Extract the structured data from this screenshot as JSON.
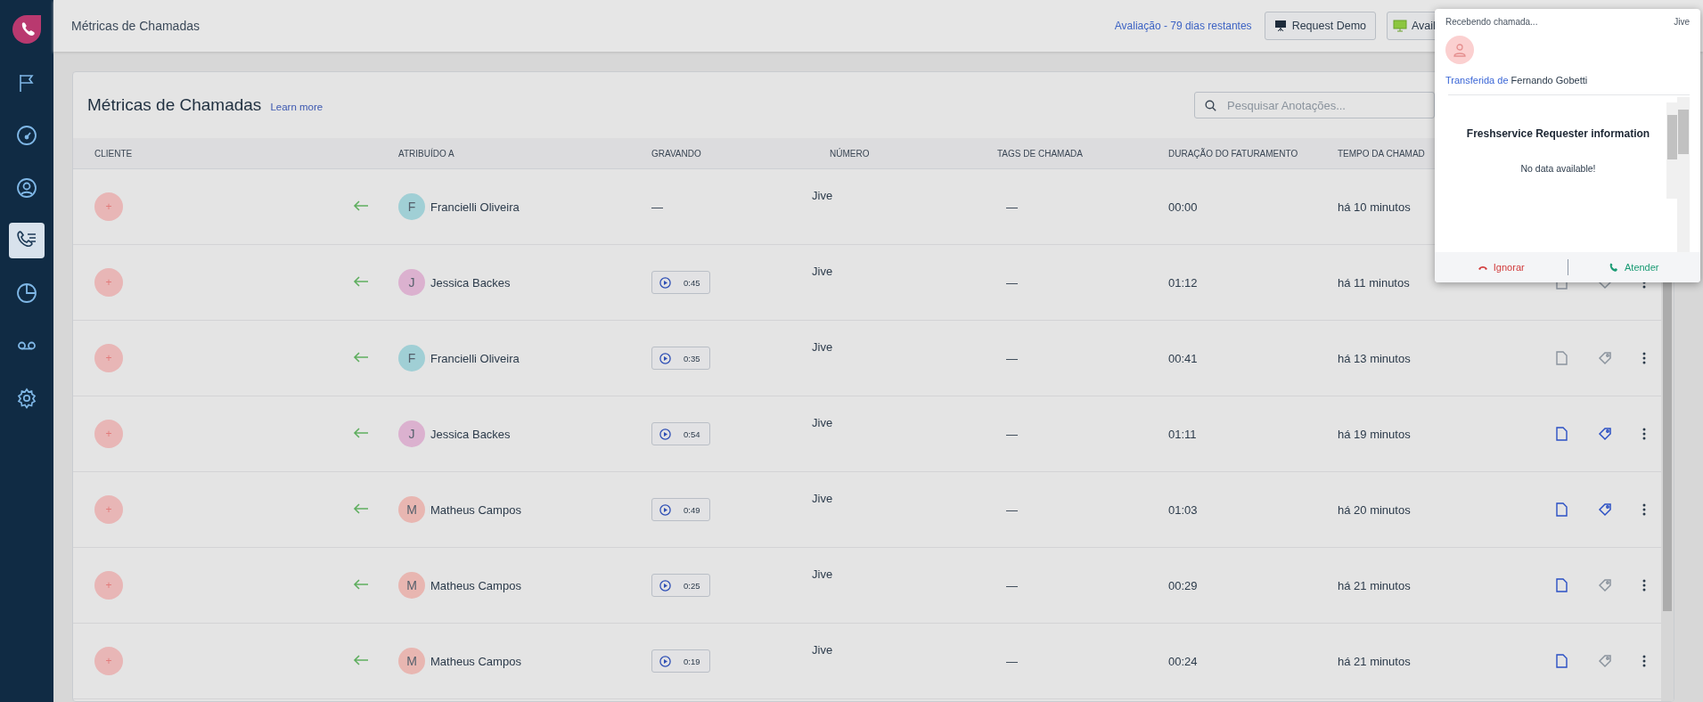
{
  "sidebar": {
    "items": [
      {
        "kind": "logo",
        "selected": false
      },
      {
        "kind": "flag",
        "selected": false
      },
      {
        "kind": "gauge",
        "selected": false
      },
      {
        "kind": "contact",
        "selected": false
      },
      {
        "kind": "calls",
        "selected": true
      },
      {
        "kind": "pie",
        "selected": false
      },
      {
        "kind": "voicemail",
        "selected": false
      },
      {
        "kind": "settings",
        "selected": false
      }
    ]
  },
  "header": {
    "title": "Métricas de Chamadas",
    "trial": "Avaliação - 79 dias restantes",
    "demo_button": "Request Demo",
    "status_button": "Avail"
  },
  "card": {
    "title": "Métricas de Chamadas",
    "learn_more": "Learn more",
    "search": {
      "placeholder": "Pesquisar Anotações..."
    }
  },
  "table": {
    "columns": [
      "CLIENTE",
      "ATRIBUÍDO A",
      "GRAVANDO",
      "NÚMERO",
      "TAGS DE CHAMADA",
      "DURAÇÃO DO FATURAMENTO",
      "TEMPO DA CHAMAD"
    ],
    "rows": [
      {
        "client": "+",
        "assignee": {
          "initial": "F",
          "name": "Francielli Oliveira",
          "color": "#a0cfd5"
        },
        "recording": {
          "kind": "none",
          "text": "—"
        },
        "number": "Jive",
        "tags": "—",
        "billing": "00:00",
        "time": "há 10 minutos"
      },
      {
        "client": "+",
        "assignee": {
          "initial": "J",
          "name": "Jessica Backes",
          "color": "#dbb1cf"
        },
        "recording": {
          "kind": "player",
          "duration": "0:45"
        },
        "number": "Jive",
        "tags": "—",
        "billing": "01:12",
        "time": "há 11 minutos",
        "note_active": false,
        "tag_active": false
      },
      {
        "client": "+",
        "assignee": {
          "initial": "F",
          "name": "Francielli Oliveira",
          "color": "#a0cfd5"
        },
        "recording": {
          "kind": "player",
          "duration": "0:35"
        },
        "number": "Jive",
        "tags": "—",
        "billing": "00:41",
        "time": "há 13 minutos",
        "note_active": false,
        "tag_active": false
      },
      {
        "client": "+",
        "assignee": {
          "initial": "J",
          "name": "Jessica Backes",
          "color": "#dbb1cf"
        },
        "recording": {
          "kind": "player",
          "duration": "0:54"
        },
        "number": "Jive",
        "tags": "—",
        "billing": "01:11",
        "time": "há 19 minutos",
        "note_active": true,
        "tag_active": true
      },
      {
        "client": "+",
        "assignee": {
          "initial": "M",
          "name": "Matheus Campos",
          "color": "#e8b6b1"
        },
        "recording": {
          "kind": "player",
          "duration": "0:49"
        },
        "number": "Jive",
        "tags": "—",
        "billing": "01:03",
        "time": "há 20 minutos",
        "note_active": true,
        "tag_active": true
      },
      {
        "client": "+",
        "assignee": {
          "initial": "M",
          "name": "Matheus Campos",
          "color": "#e8b6b1"
        },
        "recording": {
          "kind": "player",
          "duration": "0:25"
        },
        "number": "Jive",
        "tags": "—",
        "billing": "00:29",
        "time": "há 21 minutos",
        "note_active": true,
        "tag_active": false
      },
      {
        "client": "+",
        "assignee": {
          "initial": "M",
          "name": "Matheus Campos",
          "color": "#e8b6b1"
        },
        "recording": {
          "kind": "player",
          "duration": "0:19"
        },
        "number": "Jive",
        "tags": "—",
        "billing": "00:24",
        "time": "há 21 minutos",
        "note_active": true,
        "tag_active": false
      }
    ]
  },
  "incoming_call": {
    "status": "Recebendo chamada...",
    "provider": "Jive",
    "transfer_label": "Transferida de",
    "transfer_from": "Fernando Gobetti",
    "panel_title": "Freshservice Requester information",
    "panel_message": "No data available!",
    "ignore_button": "Ignorar",
    "answer_button": "Atender"
  }
}
